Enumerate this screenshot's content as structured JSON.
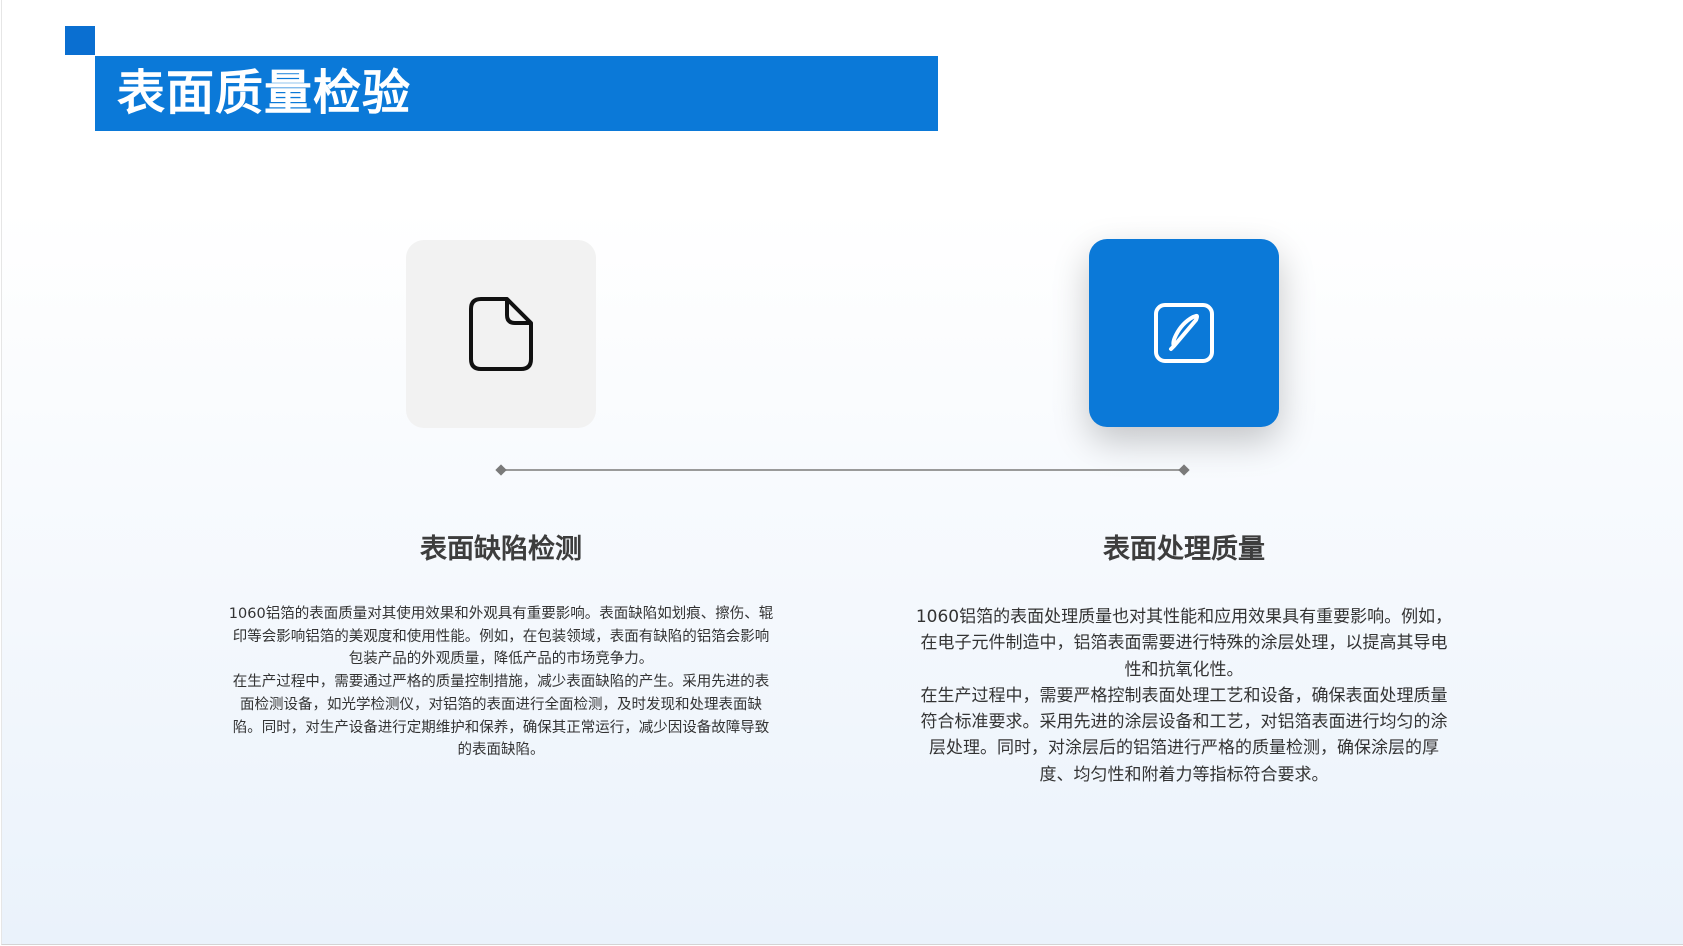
{
  "slide": {
    "title": "表面质量检验",
    "colors": {
      "brand_blue": "#0b79d8",
      "accent_blue": "#0a6fd1",
      "icon_box_gray": "#f2f2f2",
      "heading_text": "#3d3d3d",
      "body_text": "#333333",
      "timeline": "#9a9a9a"
    }
  },
  "columns": [
    {
      "icon": "document-icon",
      "heading": "表面缺陷检测",
      "paragraphs": [
        "1060铝箔的表面质量对其使用效果和外观具有重要影响。表面缺陷如划痕、擦伤、辊印等会影响铝箔的美观度和使用性能。例如，在包装领域，表面有缺陷的铝箔会影响包装产品的外观质量，降低产品的市场竞争力。",
        "在生产过程中，需要通过严格的质量控制措施，减少表面缺陷的产生。采用先进的表面检测设备，如光学检测仪，对铝箔的表面进行全面检测，及时发现和处理表面缺陷。同时，对生产设备进行定期维护和保养，确保其正常运行，减少因设备故障导致的表面缺陷。"
      ]
    },
    {
      "icon": "edit-icon",
      "heading": "表面处理质量",
      "paragraphs": [
        "1060铝箔的表面处理质量也对其性能和应用效果具有重要影响。例如，在电子元件制造中，铝箔表面需要进行特殊的涂层处理，以提高其导电性和抗氧化性。",
        "在生产过程中，需要严格控制表面处理工艺和设备，确保表面处理质量符合标准要求。采用先进的涂层设备和工艺，对铝箔表面进行均匀的涂层处理。同时，对涂层后的铝箔进行严格的质量检测，确保涂层的厚度、均匀性和附着力等指标符合要求。"
      ]
    }
  ]
}
